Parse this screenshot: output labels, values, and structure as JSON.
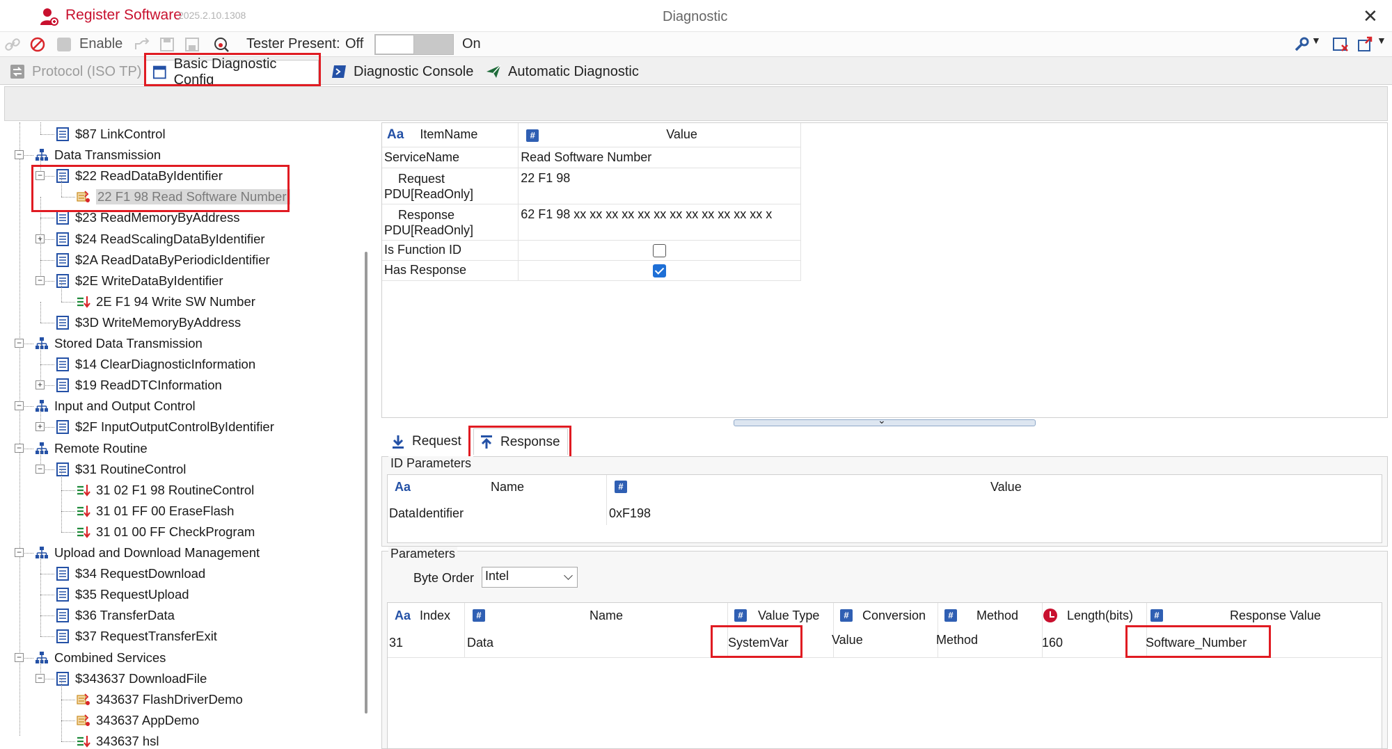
{
  "app": {
    "register_label": "Register Software",
    "version": "2025.2.10.1308",
    "window_title": "Diagnostic",
    "close_glyph": "✕"
  },
  "toolbar": {
    "enable_label": "Enable",
    "tester_present_label": "Tester Present:",
    "off_label": "Off",
    "on_label": "On"
  },
  "main_tabs": [
    {
      "label": "Protocol (ISO TP)",
      "state": "disabled"
    },
    {
      "label": "Basic Diagnostic Config",
      "state": "active"
    },
    {
      "label": "Diagnostic Console",
      "state": "normal"
    },
    {
      "label": "Automatic Diagnostic",
      "state": "normal"
    }
  ],
  "tree": [
    {
      "label": "$87 LinkControl"
    },
    {
      "label": "Data Transmission"
    },
    {
      "label": "$22 ReadDataByIdentifier"
    },
    {
      "label": "22 F1 98 Read Software Number"
    },
    {
      "label": "$23 ReadMemoryByAddress"
    },
    {
      "label": "$24 ReadScalingDataByIdentifier"
    },
    {
      "label": "$2A ReadDataByPeriodicIdentifier"
    },
    {
      "label": "$2E WriteDataByIdentifier"
    },
    {
      "label": "2E F1 94 Write SW Number"
    },
    {
      "label": "$3D WriteMemoryByAddress"
    },
    {
      "label": "Stored Data Transmission"
    },
    {
      "label": "$14 ClearDiagnosticInformation"
    },
    {
      "label": "$19 ReadDTCInformation"
    },
    {
      "label": "Input and Output Control"
    },
    {
      "label": "$2F InputOutputControlByIdentifier"
    },
    {
      "label": "Remote Routine"
    },
    {
      "label": "$31 RoutineControl"
    },
    {
      "label": "31 02 F1 98 RoutineControl"
    },
    {
      "label": "31 01 FF 00 EraseFlash"
    },
    {
      "label": "31 01 00 FF CheckProgram"
    },
    {
      "label": "Upload and Download Management"
    },
    {
      "label": "$34 RequestDownload"
    },
    {
      "label": "$35 RequestUpload"
    },
    {
      "label": "$36 TransferData"
    },
    {
      "label": "$37 RequestTransferExit"
    },
    {
      "label": "Combined Services"
    },
    {
      "label": "$343637 DownloadFile"
    },
    {
      "label": "343637 FlashDriverDemo"
    },
    {
      "label": "343637 AppDemo"
    },
    {
      "label": "343637 hsl"
    }
  ],
  "properties": {
    "header": {
      "aa": "Aa",
      "item_name": "ItemName",
      "hash": "#",
      "value": "Value"
    },
    "rows": [
      {
        "name": "ServiceName",
        "value": "Read Software Number"
      },
      {
        "name_line1": "Request",
        "name_line2": "PDU[ReadOnly]",
        "value": "22 F1 98"
      },
      {
        "name_line1": "Response",
        "name_line2": "PDU[ReadOnly]",
        "value": "62 F1 98 xx xx xx xx xx xx xx xx xx xx xx xx x"
      },
      {
        "name": "Is Function ID",
        "checked": false
      },
      {
        "name": "Has Response",
        "checked": true
      }
    ]
  },
  "sub_tabs": {
    "request": "Request",
    "response": "Response"
  },
  "id_parameters": {
    "title": "ID Parameters",
    "header": {
      "aa": "Aa",
      "name": "Name",
      "hash": "#",
      "value": "Value"
    },
    "row": {
      "name": "DataIdentifier",
      "value": "0xF198"
    }
  },
  "parameters": {
    "title": "Parameters",
    "byte_order_label": "Byte Order",
    "byte_order_value": "Intel",
    "header": {
      "aa": "Aa",
      "index": "Index",
      "hash": "#",
      "name": "Name",
      "value_type": "Value Type",
      "conversion": "Conversion",
      "method": "Method",
      "length": "Length(bits)",
      "response_value": "Response Value"
    },
    "row": {
      "index": "31",
      "name": "Data",
      "value_type": "SystemVar",
      "conversion": "Value",
      "method": "Method",
      "length": "160",
      "response_value": "Software_Number"
    }
  },
  "colors": {
    "accent_red": "#e01b22",
    "brand_red": "#c8102e",
    "accent_blue": "#2f5fb3"
  }
}
